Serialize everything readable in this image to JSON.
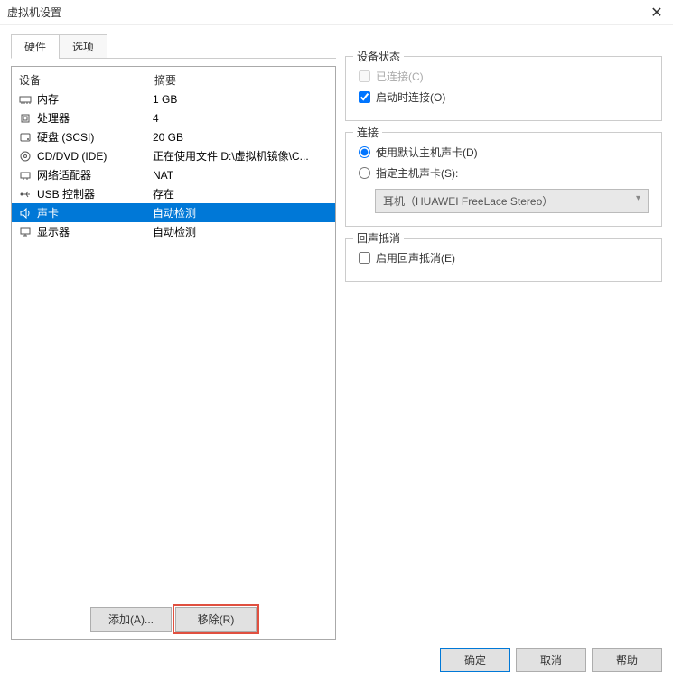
{
  "window": {
    "title": "虚拟机设置"
  },
  "tabs": {
    "hardware": "硬件",
    "options": "选项"
  },
  "headers": {
    "device": "设备",
    "summary": "摘要"
  },
  "devices": [
    {
      "icon": "memory",
      "name": "内存",
      "summary": "1 GB"
    },
    {
      "icon": "cpu",
      "name": "处理器",
      "summary": "4"
    },
    {
      "icon": "disk",
      "name": "硬盘 (SCSI)",
      "summary": "20 GB"
    },
    {
      "icon": "cd",
      "name": "CD/DVD (IDE)",
      "summary": "正在使用文件 D:\\虚拟机镜像\\C..."
    },
    {
      "icon": "network",
      "name": "网络适配器",
      "summary": "NAT"
    },
    {
      "icon": "usb",
      "name": "USB 控制器",
      "summary": "存在"
    },
    {
      "icon": "sound",
      "name": "声卡",
      "summary": "自动检测",
      "selected": true
    },
    {
      "icon": "display",
      "name": "显示器",
      "summary": "自动检测"
    }
  ],
  "buttons": {
    "add": "添加(A)...",
    "remove": "移除(R)",
    "ok": "确定",
    "cancel": "取消",
    "help": "帮助"
  },
  "right": {
    "device_status": {
      "title": "设备状态",
      "connected": "已连接(C)",
      "connect_power_on": "启动时连接(O)"
    },
    "connection": {
      "title": "连接",
      "use_default": "使用默认主机声卡(D)",
      "specify": "指定主机声卡(S):",
      "select_value": "耳机（HUAWEI FreeLace Stereo）"
    },
    "echo": {
      "title": "回声抵消",
      "enable": "启用回声抵消(E)"
    }
  }
}
